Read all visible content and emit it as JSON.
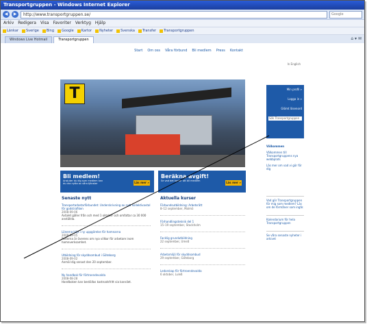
{
  "window": {
    "title": "Transportgruppen - Windows Internet Explorer",
    "url": "http://www.transportgruppen.se/",
    "search_placeholder": "Google"
  },
  "menu": [
    "Arkiv",
    "Redigera",
    "Visa",
    "Favoriter",
    "Verktyg",
    "Hjälp"
  ],
  "favorites": [
    "Länkar",
    "Sverige",
    "Bing",
    "Google",
    "Kartor",
    "Nyheter",
    "Svenska",
    "Transfer",
    "Transportgruppen"
  ],
  "tabs": [
    {
      "label": "Windows Live Hotmail",
      "active": false
    },
    {
      "label": "Transportgruppen",
      "active": true
    }
  ],
  "site": {
    "nav": [
      "Start",
      "Om oss",
      "Våra förbund",
      "Bli medlem",
      "Press",
      "Kontakt"
    ],
    "login_link": "In English",
    "login_box": {
      "member_link": "Min profil »",
      "logout_link": "Logga in »",
      "forgot_link": "Glömt lösenord",
      "search_placeholder": "Sök Transportgruppen"
    },
    "sidebar_news": [
      "Välkommen",
      "Välkommen till Transportgruppens nya webbplats",
      "Läs mer om vad vi gör för dig"
    ],
    "banners": [
      {
        "title": "Bli medlem!",
        "sub": "Ansluter du dig som medlem kan du dra nytta av våra tjänster",
        "button": "Läs mer »"
      },
      {
        "title": "Beräkna avgift!",
        "sub": "Se vad det kostar att bli medlem",
        "button": "Läs mer »"
      }
    ],
    "left_column": {
      "title": "Senaste nytt",
      "items": [
        {
          "head": "Transportarbetarförbundet: Underskrivning av nytt kollektivavtal för godstrafiken",
          "meta": "2008-09-06",
          "body": "Avtalet gäller från och med 1 oktober och omfattar ca 30 000 anställda."
        },
        {
          "head": "Lönerna höjs i ny uppgörelse för hamnarna",
          "meta": "2008-09-05",
          "body": "Parterna är överens om nya villkor för arbetare inom hamnverksamhet."
        },
        {
          "head": "Utbildning för skyddsombud i Göteborg",
          "meta": "2008-09-02",
          "body": "Anmäl dig senast den 20 september."
        },
        {
          "head": "Ny handbok för förtroendevalda",
          "meta": "2008-08-28",
          "body": "Handboken kan beställas kostnadsfritt via kansliet."
        }
      ]
    },
    "mid_column": {
      "title": "Aktuella kurser",
      "items": [
        {
          "head": "Förbundsutbildning: Arbetsrätt",
          "meta": "8–12 september, Malmö"
        },
        {
          "head": "Förhandlingsteknik del 1",
          "meta": "15–19 september, Stockholm"
        },
        {
          "head": "Facklig grundutbildning",
          "meta": "22 september, Umeå"
        },
        {
          "head": "Arbetsmiljö för skyddsombud",
          "meta": "29 september, Göteborg"
        },
        {
          "head": "Ledarskap för förtroendevalda",
          "meta": "6 oktober, Luleå"
        }
      ]
    },
    "right_mid": [
      {
        "text": "Vad gör Transportgruppen för mig som medlem? Läs om de förmåner som ingår."
      },
      {
        "text": "Kalendarium för hela Transportgruppen"
      },
      {
        "text": "Se våra senaste nyheter i arkivet"
      }
    ]
  },
  "colors": {
    "brand_blue": "#1e5aa8",
    "brand_yellow": "#f4d100",
    "button_orange": "#f2b300"
  }
}
